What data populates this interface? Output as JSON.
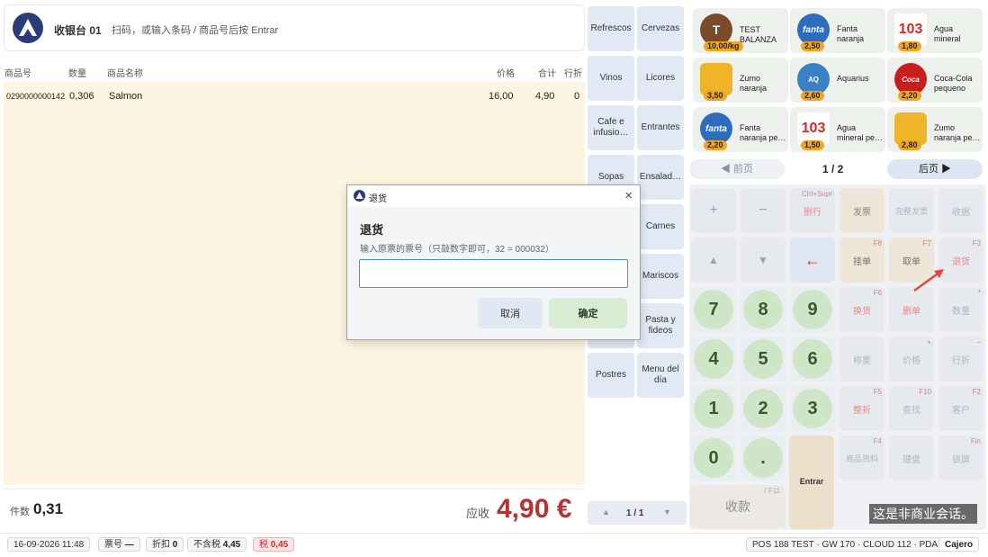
{
  "header": {
    "station": "收银台 01",
    "hint": "扫码，或输入条码 / 商品号后按 Entrar"
  },
  "columns": {
    "code": "商品号",
    "qty": "数量",
    "name": "商品名称",
    "price": "价格",
    "total": "合计",
    "discount": "行折"
  },
  "items": [
    {
      "code": "0290000000142",
      "qty": "0,306",
      "name": "Salmon",
      "price": "16,00",
      "total": "4,90",
      "discount": "0"
    }
  ],
  "totals": {
    "count_label": "件数",
    "count": "0,31",
    "due_label": "应收",
    "due": "4,90 €"
  },
  "categories": [
    "Refrescos",
    "Cervezas",
    "Vinos",
    "Licores",
    "Cafe e infusio…",
    "Entrantes",
    "Sopas",
    "Ensalad…",
    "",
    "Carnes",
    "",
    "Mariscos",
    "",
    "Pasta y fideos",
    "Postres",
    "Menu del día"
  ],
  "category_pager": {
    "prev": "▲",
    "page": "1 / 1",
    "next": "▼"
  },
  "products": [
    {
      "name": "TEST BALANZA",
      "price": "10,00/kg",
      "icon": "T",
      "color": "#7a4a2b"
    },
    {
      "name": "Fanta naranja",
      "price": "2,50",
      "icon": "fanta",
      "color": "#2e6dbd"
    },
    {
      "name": "Agua mineral",
      "price": "1,80",
      "icon": "103",
      "color": "#d42a2a"
    },
    {
      "name": "Zumo naranja",
      "price": "3,50",
      "icon": "juice",
      "color": "#f0b429"
    },
    {
      "name": "Aquarius",
      "price": "2,60",
      "icon": "aquarius",
      "color": "#3b7fc4"
    },
    {
      "name": "Coca-Cola pequeno",
      "price": "2,20",
      "icon": "coke",
      "color": "#c81e1e"
    },
    {
      "name": "Fanta naranja pe…",
      "price": "2,20",
      "icon": "fanta",
      "color": "#2e6dbd"
    },
    {
      "name": "Agua mineral pe…",
      "price": "1,50",
      "icon": "103",
      "color": "#d42a2a"
    },
    {
      "name": "Zumo naranja pe…",
      "price": "2,80",
      "icon": "juice",
      "color": "#f0b429"
    }
  ],
  "product_pager": {
    "prev": "◀ 前页",
    "page": "1 / 2",
    "next": "后页 ▶"
  },
  "keypad": {
    "row1": [
      {
        "label": "+",
        "shortcut": ""
      },
      {
        "label": "−",
        "shortcut": ""
      },
      {
        "label": "删行",
        "shortcut": "Ctrl+Supr"
      },
      {
        "label": "发票",
        "shortcut": ""
      },
      {
        "label": "完整发票",
        "shortcut": ""
      },
      {
        "label": "收据",
        "shortcut": ""
      }
    ],
    "row2": [
      {
        "label": "▲",
        "shortcut": ""
      },
      {
        "label": "▼",
        "shortcut": ""
      },
      {
        "label": "←",
        "shortcut": ""
      },
      {
        "label": "挂单",
        "shortcut": "F8"
      },
      {
        "label": "取单",
        "shortcut": "F7"
      },
      {
        "label": "退货",
        "shortcut": "F3"
      }
    ],
    "row3": [
      {
        "label": "7"
      },
      {
        "label": "8"
      },
      {
        "label": "9"
      },
      {
        "label": "换货",
        "shortcut": "F6"
      },
      {
        "label": "删单",
        "shortcut": ""
      },
      {
        "label": "数量",
        "shortcut": "*"
      }
    ],
    "row4": [
      {
        "label": "4"
      },
      {
        "label": "5"
      },
      {
        "label": "6"
      },
      {
        "label": "称重",
        "shortcut": ""
      },
      {
        "label": "价格",
        "shortcut": "+"
      },
      {
        "label": "行折",
        "shortcut": "−"
      }
    ],
    "row5": [
      {
        "label": "1"
      },
      {
        "label": "2"
      },
      {
        "label": "3"
      },
      {
        "label": "整折",
        "shortcut": "F5"
      },
      {
        "label": "查找",
        "shortcut": "F10"
      },
      {
        "label": "客户",
        "shortcut": "F2"
      }
    ],
    "row6": [
      {
        "label": "0"
      },
      {
        "label": "."
      },
      {
        "label": "商品资料",
        "shortcut": "F4"
      },
      {
        "label": "键盘",
        "shortcut": ""
      },
      {
        "label": "锁屏",
        "shortcut": "Fin"
      }
    ],
    "entrar": "Entrar",
    "charge": "收款",
    "charge_shortcut": "/ F11"
  },
  "watermark": "这是非商业会话。",
  "status": {
    "datetime": "16-09-2026 11:48",
    "ticket_label": "票号",
    "ticket": "—",
    "discount_label": "折扣",
    "discount": "0",
    "net_label": "不含税",
    "net": "4,45",
    "tax_label": "税",
    "tax": "0,45",
    "system": "POS 188 TEST · GW 170 · CLOUD 112 · PDA 70",
    "user": "Cajero"
  },
  "dialog": {
    "title": "退货",
    "heading": "退货",
    "subtitle": "输入原票的票号（只敲数字即可，32 = 000032）",
    "input_value": "",
    "cancel": "取消",
    "ok": "确定"
  }
}
